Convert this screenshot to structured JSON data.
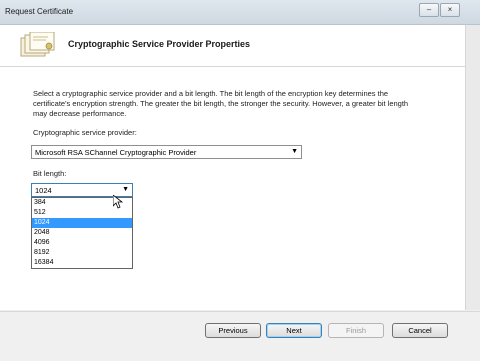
{
  "window": {
    "title": "Request Certificate",
    "controls": [
      "minimize-icon",
      "close-icon"
    ]
  },
  "header": {
    "title": "Cryptographic Service Provider Properties",
    "icon": "certificate-icon"
  },
  "content": {
    "description": "Select a cryptographic service provider and a bit length.  The bit length of the encryption key determines the certificate's encryption strength. The greater the bit length, the stronger the security. However, a greater bit length may decrease performance.",
    "provider_label": "Cryptographic service provider:",
    "provider_value": "Microsoft RSA SChannel Cryptographic Provider",
    "bitlength_label": "Bit length:",
    "bitlength_value": "1024",
    "bitlength_options": [
      "384",
      "512",
      "1024",
      "2048",
      "4096",
      "8192",
      "16384"
    ],
    "selected_index": 2
  },
  "buttons": {
    "previous": "Previous",
    "next": "Next",
    "finish": "Finish",
    "cancel": "Cancel"
  },
  "colors": {
    "selection": "#3399ff",
    "accent_border": "#3c7fb1"
  }
}
